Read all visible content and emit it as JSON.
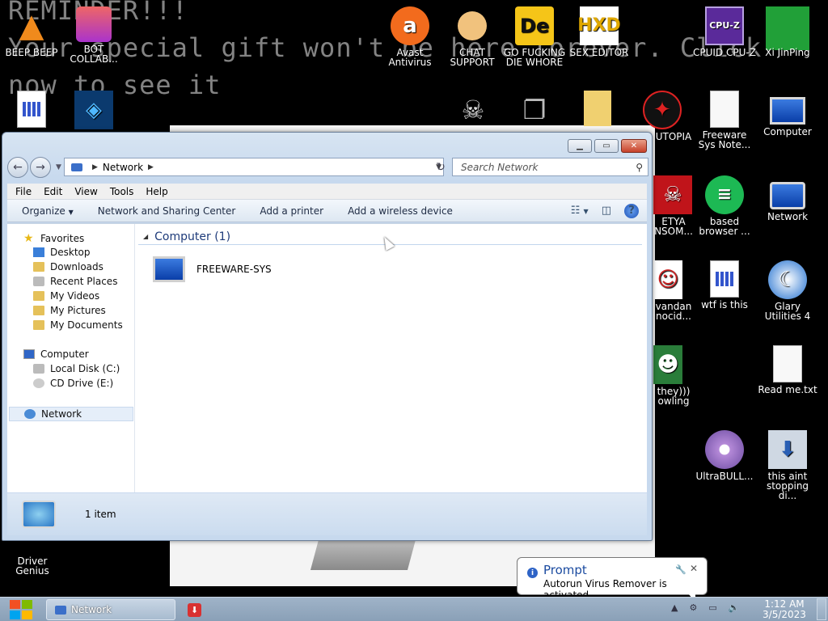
{
  "wallpaper": {
    "line1": "REMINDER!!!",
    "line2": "Your special gift won't be here forever. Click",
    "line3": "now to see it"
  },
  "desktop_icons": [
    {
      "label": "BEEP BEEP",
      "icon": "vlc-cone-icon"
    },
    {
      "label": "BOT COLLAB...",
      "icon": "bot-collab-icon"
    },
    {
      "label": "Avast Antivirus",
      "icon": "avast-icon"
    },
    {
      "label": "CHAT SUPPORT",
      "icon": "doctor-icon"
    },
    {
      "label": "GO FUCKING DIE WHORE",
      "icon": "de-icon"
    },
    {
      "label": "SEX EDITOR",
      "icon": "hxd-icon"
    },
    {
      "label": "CPUID CPU-Z",
      "icon": "cpuz-icon"
    },
    {
      "label": "Xi JinPing",
      "icon": "xijinping-icon"
    },
    {
      "label": "UTOPIA",
      "icon": "utopia-icon"
    },
    {
      "label": "Freeware Sys Note...",
      "icon": "document-icon"
    },
    {
      "label": "Computer",
      "icon": "computer-icon"
    },
    {
      "label": "ETYA NSOM...",
      "icon": "skull-icon"
    },
    {
      "label": "based browser ...",
      "icon": "browser-icon"
    },
    {
      "label": "Network",
      "icon": "network-icon"
    },
    {
      "label": "vandan nocid...",
      "icon": "troll-icon"
    },
    {
      "label": "wtf is this",
      "icon": "document-icon"
    },
    {
      "label": "Glary Utilities 4",
      "icon": "glary-icon"
    },
    {
      "label": "they))) owling",
      "icon": "santa-icon"
    },
    {
      "label": "Read me.txt",
      "icon": "text-file-icon"
    },
    {
      "label": "UltraBULL...",
      "icon": "disc-icon"
    },
    {
      "label": "this aint stopping di...",
      "icon": "network-install-icon"
    },
    {
      "label": "Driver Genius",
      "icon": "driver-genius-icon"
    }
  ],
  "window": {
    "address": {
      "segment": "Network"
    },
    "search_placeholder": "Search Network",
    "menu": [
      "File",
      "Edit",
      "View",
      "Tools",
      "Help"
    ],
    "toolbar": {
      "organize": "Organize",
      "sharing": "Network and Sharing Center",
      "printer": "Add a printer",
      "wireless": "Add a wireless device"
    },
    "nav": {
      "favorites": "Favorites",
      "desktop": "Desktop",
      "downloads": "Downloads",
      "recent": "Recent Places",
      "videos": "My Videos",
      "pictures": "My Pictures",
      "documents": "My Documents",
      "computer": "Computer",
      "local_disk": "Local Disk (C:)",
      "cd_drive": "CD Drive (E:)",
      "network": "Network"
    },
    "group_header": "Computer (1)",
    "items": [
      {
        "name": "FREEWARE-SYS"
      }
    ],
    "status": "1 item"
  },
  "balloon": {
    "title": "Prompt",
    "text": "Autorun Virus Remover is activated"
  },
  "taskbar": {
    "network_button": "Network",
    "time": "1:12 AM",
    "date": "3/5/2023"
  },
  "colors": {
    "start_red": "#f25022",
    "start_green": "#7fba00",
    "start_blue": "#00a4ef",
    "start_yellow": "#ffb900"
  }
}
